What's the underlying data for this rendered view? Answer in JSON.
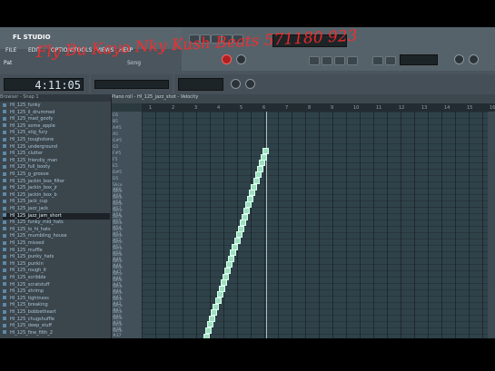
{
  "window": {
    "title": "FL STUDIO"
  },
  "menu": [
    "FILE",
    "EDIT",
    "OPTIONS",
    "TOOLS",
    "VIEWS",
    "HELP"
  ],
  "toolbar": {
    "pattern_mode": "Pat",
    "time_display": "4:11:05",
    "hint_text": "Song"
  },
  "watermark": "Fly Bu Kayo Nky Kush Beats 571180 923",
  "browser": {
    "header": "Browser - Snap 1",
    "items": [
      "HI_125_funky",
      "HI_125_il_drummed",
      "HI_125_mad_goofy",
      "HI_125_some_apple",
      "HI_125_stig_fury",
      "HI_125_toughstone",
      "HI_125_underground",
      "HI_125_clutter",
      "HI_125_friendly_man",
      "HI_125_full_booty",
      "HI_125_g_groove",
      "HI_125_jackin_box_filter",
      "HI_125_jackin_box_jr",
      "HI_125_jackin_box_b",
      "HI_125_jack_cup",
      "HI_125_jazz_jack",
      "HI_125_jazz_jam_short",
      "HI_125_funky_mid_hats",
      "HI_125_lo_hi_hats",
      "HI_125_mumbling_house",
      "HI_125_missed",
      "HI_125_muffle",
      "HI_125_punky_hats",
      "HI_125_punkin",
      "HI_125_rough_it",
      "HI_125_scribble",
      "HI_125_scratstuff",
      "HI_125_shrimp",
      "HI_125_tightness",
      "HI_125_breaking",
      "HI_125_bobbetheart",
      "HI_125_chugshuffle",
      "HI_125_deep_stuff",
      "HI_125_fine_filth_2"
    ],
    "selected_index": 16
  },
  "pianoroll": {
    "title": "Piano roll - HI_125_jazz_shot - Velocity",
    "bars": [
      "1",
      "2",
      "3",
      "4",
      "5",
      "6",
      "7",
      "8",
      "9",
      "10",
      "11",
      "12",
      "13",
      "14",
      "15",
      "16"
    ],
    "key_labels": [
      "C6",
      "B5",
      "A#5",
      "A5",
      "G#5",
      "G5",
      "F#5",
      "F5",
      "E5",
      "D#5",
      "D5",
      "Slice #60",
      "Slice #59",
      "Slice #58",
      "Slice #57",
      "Slice #56",
      "Slice #55",
      "Slice #54",
      "Slice #53",
      "Slice #52",
      "Slice #51",
      "Slice #50",
      "Slice #49",
      "Slice #48",
      "Slice #47",
      "Slice #46",
      "Slice #45",
      "Slice #44",
      "Slice #43",
      "Slice #42",
      "Slice #41",
      "Slice #40",
      "Slice #39",
      "Slice #38",
      "Slice #37"
    ]
  }
}
